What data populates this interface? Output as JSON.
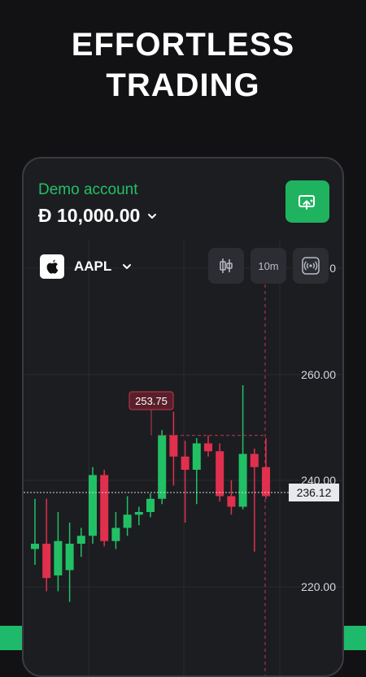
{
  "headline": {
    "line1": "EFFORTLESS",
    "line2": "TRADING"
  },
  "account": {
    "label": "Demo account",
    "balance": "Đ 10,000.00"
  },
  "symbol": {
    "ticker": "AAPL",
    "icon": "apple-logo-icon"
  },
  "toolbar": {
    "chart_type_icon": "candlestick-icon",
    "timeframe": "10m",
    "signal_icon": "broadcast-icon"
  },
  "deposit": {
    "icon": "deposit-upload-icon"
  },
  "colors": {
    "up": "#22c065",
    "down": "#e0304e",
    "accent": "#1fb35f",
    "background": "#121214",
    "panel": "#1c1d21"
  },
  "chart_data": {
    "type": "candlestick",
    "y_tick_labels": [
      "0",
      "260.00",
      "240.00",
      "220.00"
    ],
    "current_price": "236.12",
    "highlight_price": "253.75",
    "ylim": [
      215,
      280
    ],
    "candles": [
      {
        "o": 227.0,
        "h": 236.5,
        "l": 224.0,
        "c": 228.0
      },
      {
        "o": 228.0,
        "h": 236.5,
        "l": 219.0,
        "c": 221.5
      },
      {
        "o": 222.0,
        "h": 234.0,
        "l": 219.0,
        "c": 228.5
      },
      {
        "o": 223.0,
        "h": 232.0,
        "l": 217.0,
        "c": 228.0
      },
      {
        "o": 228.0,
        "h": 231.0,
        "l": 225.5,
        "c": 229.5
      },
      {
        "o": 229.5,
        "h": 242.5,
        "l": 228.0,
        "c": 241.0
      },
      {
        "o": 241.0,
        "h": 242.0,
        "l": 227.5,
        "c": 228.5
      },
      {
        "o": 228.5,
        "h": 234.0,
        "l": 227.0,
        "c": 231.0
      },
      {
        "o": 231.0,
        "h": 237.0,
        "l": 229.5,
        "c": 233.5
      },
      {
        "o": 233.5,
        "h": 235.0,
        "l": 231.5,
        "c": 234.0
      },
      {
        "o": 234.0,
        "h": 237.5,
        "l": 233.0,
        "c": 236.5
      },
      {
        "o": 236.5,
        "h": 249.5,
        "l": 235.5,
        "c": 248.5
      },
      {
        "o": 248.5,
        "h": 253.0,
        "l": 239.0,
        "c": 244.5
      },
      {
        "o": 244.5,
        "h": 247.5,
        "l": 232.0,
        "c": 242.0
      },
      {
        "o": 242.0,
        "h": 248.0,
        "l": 235.5,
        "c": 247.0
      },
      {
        "o": 247.0,
        "h": 248.5,
        "l": 244.5,
        "c": 245.5
      },
      {
        "o": 245.5,
        "h": 247.0,
        "l": 236.0,
        "c": 237.0
      },
      {
        "o": 237.0,
        "h": 240.0,
        "l": 233.5,
        "c": 235.0
      },
      {
        "o": 235.0,
        "h": 258.0,
        "l": 234.5,
        "c": 245.0
      },
      {
        "o": 245.0,
        "h": 246.0,
        "l": 226.5,
        "c": 242.5
      },
      {
        "o": 242.5,
        "h": 248.0,
        "l": 236.5,
        "c": 237.0
      }
    ]
  }
}
